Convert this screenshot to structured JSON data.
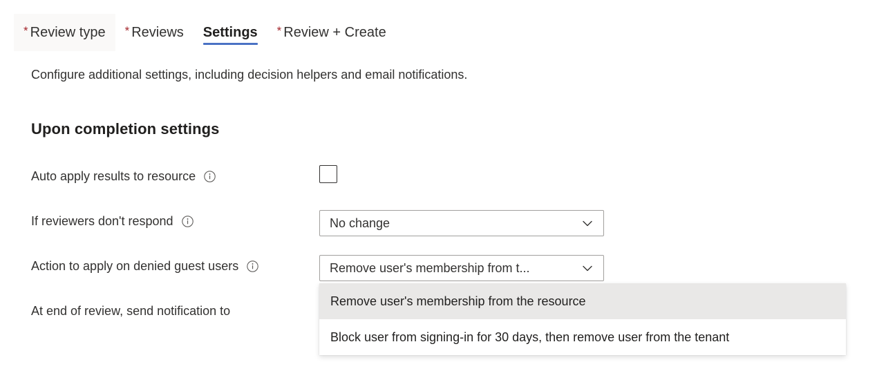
{
  "tabs": [
    {
      "label": "Review type",
      "required": true,
      "active": false,
      "hovered": true
    },
    {
      "label": "Reviews",
      "required": true,
      "active": false,
      "hovered": false
    },
    {
      "label": "Settings",
      "required": false,
      "active": true,
      "hovered": false
    },
    {
      "label": "Review + Create",
      "required": true,
      "active": false,
      "hovered": false
    }
  ],
  "required_marker": "*",
  "page": {
    "description": "Configure additional settings, including decision helpers and email notifications.",
    "section_heading": "Upon completion settings"
  },
  "form": {
    "rows": [
      {
        "label": "Auto apply results to resource",
        "info_icon": "info-icon",
        "control": "checkbox",
        "checked": false
      },
      {
        "label": "If reviewers don't respond",
        "info_icon": "info-icon",
        "control": "combobox",
        "value": "No change",
        "chevron_icon": "chevron-down-icon"
      },
      {
        "label": "Action to apply on denied guest users",
        "info_icon": "info-icon",
        "control": "combobox",
        "value": "Remove user's membership from t...",
        "chevron_icon": "chevron-down-icon"
      },
      {
        "label": "At end of review, send notification to",
        "info_icon": null,
        "control": "none",
        "value": ""
      }
    ]
  },
  "dropdown": {
    "open": true,
    "belongs_to": "Action to apply on denied guest users",
    "options": [
      {
        "label": "Remove user's membership from the resource",
        "selected": true
      },
      {
        "label": "Block user from signing-in for 30 days, then remove user from the tenant",
        "selected": false
      }
    ]
  },
  "colors": {
    "accent_blue": "#4a72c4",
    "required_red": "#a4262c",
    "text": "#323130",
    "option_selected_bg": "#e9e8e7",
    "tab_hover_bg": "#faf9f8"
  }
}
